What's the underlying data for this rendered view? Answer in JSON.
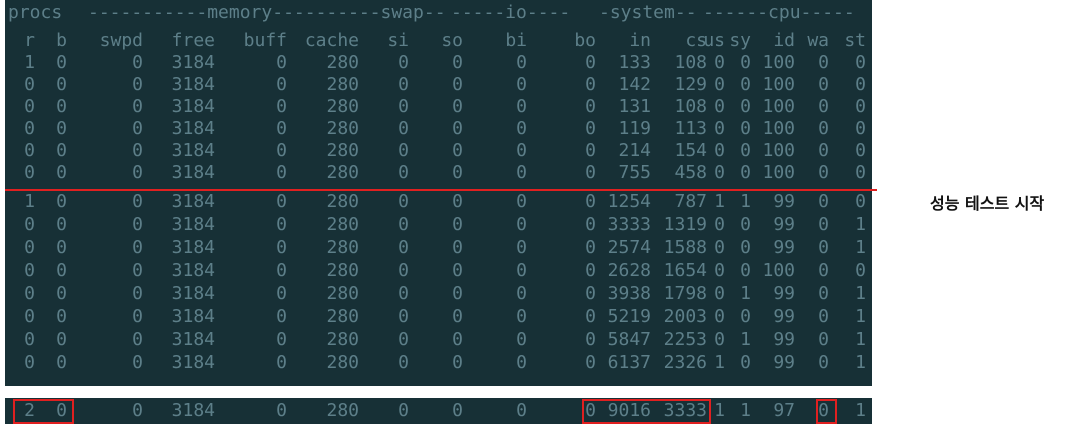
{
  "header_groups": {
    "procs": "procs",
    "memory": "-----------memory----------",
    "swap": "---swap--",
    "io": "-----io----",
    "system": "-system--",
    "cpu": "------cpu-----"
  },
  "columns": [
    "r",
    "b",
    "swpd",
    "free",
    "buff",
    "cache",
    "si",
    "so",
    "bi",
    "bo",
    "in",
    "cs",
    "us",
    "sy",
    "id",
    "wa",
    "st"
  ],
  "rows_before": [
    [
      "1",
      "0",
      "0",
      "3184",
      "0",
      "280",
      "0",
      "0",
      "0",
      "0",
      "133",
      "108",
      "0",
      "0",
      "100",
      "0",
      "0"
    ],
    [
      "0",
      "0",
      "0",
      "3184",
      "0",
      "280",
      "0",
      "0",
      "0",
      "0",
      "142",
      "129",
      "0",
      "0",
      "100",
      "0",
      "0"
    ],
    [
      "0",
      "0",
      "0",
      "3184",
      "0",
      "280",
      "0",
      "0",
      "0",
      "0",
      "131",
      "108",
      "0",
      "0",
      "100",
      "0",
      "0"
    ],
    [
      "0",
      "0",
      "0",
      "3184",
      "0",
      "280",
      "0",
      "0",
      "0",
      "0",
      "119",
      "113",
      "0",
      "0",
      "100",
      "0",
      "0"
    ],
    [
      "0",
      "0",
      "0",
      "3184",
      "0",
      "280",
      "0",
      "0",
      "0",
      "0",
      "214",
      "154",
      "0",
      "0",
      "100",
      "0",
      "0"
    ],
    [
      "0",
      "0",
      "0",
      "3184",
      "0",
      "280",
      "0",
      "0",
      "0",
      "0",
      "755",
      "458",
      "0",
      "0",
      "100",
      "0",
      "0"
    ]
  ],
  "rows_after": [
    [
      "1",
      "0",
      "0",
      "3184",
      "0",
      "280",
      "0",
      "0",
      "0",
      "0",
      "1254",
      "787",
      "1",
      "1",
      "99",
      "0",
      "0"
    ],
    [
      "0",
      "0",
      "0",
      "3184",
      "0",
      "280",
      "0",
      "0",
      "0",
      "0",
      "3333",
      "1319",
      "0",
      "0",
      "99",
      "0",
      "1"
    ],
    [
      "0",
      "0",
      "0",
      "3184",
      "0",
      "280",
      "0",
      "0",
      "0",
      "0",
      "2574",
      "1588",
      "0",
      "0",
      "99",
      "0",
      "1"
    ],
    [
      "0",
      "0",
      "0",
      "3184",
      "0",
      "280",
      "0",
      "0",
      "0",
      "0",
      "2628",
      "1654",
      "0",
      "0",
      "100",
      "0",
      "0"
    ],
    [
      "0",
      "0",
      "0",
      "3184",
      "0",
      "280",
      "0",
      "0",
      "0",
      "0",
      "3938",
      "1798",
      "0",
      "1",
      "99",
      "0",
      "1"
    ],
    [
      "0",
      "0",
      "0",
      "3184",
      "0",
      "280",
      "0",
      "0",
      "0",
      "0",
      "5219",
      "2003",
      "0",
      "0",
      "99",
      "0",
      "1"
    ],
    [
      "0",
      "0",
      "0",
      "3184",
      "0",
      "280",
      "0",
      "0",
      "0",
      "0",
      "5847",
      "2253",
      "0",
      "1",
      "99",
      "0",
      "1"
    ],
    [
      "0",
      "0",
      "0",
      "3184",
      "0",
      "280",
      "0",
      "0",
      "0",
      "0",
      "6137",
      "2326",
      "1",
      "0",
      "99",
      "0",
      "1"
    ]
  ],
  "highlight_row": [
    "2",
    "0",
    "0",
    "3184",
    "0",
    "280",
    "0",
    "0",
    "0",
    "0",
    "9016",
    "3333",
    "1",
    "1",
    "97",
    "0",
    "1"
  ],
  "annotation": {
    "label": "성능 테스트 시작",
    "highlight_color": "#e02020"
  },
  "colors": {
    "terminal_bg": "#173036",
    "terminal_fg": "#5d7f89"
  }
}
